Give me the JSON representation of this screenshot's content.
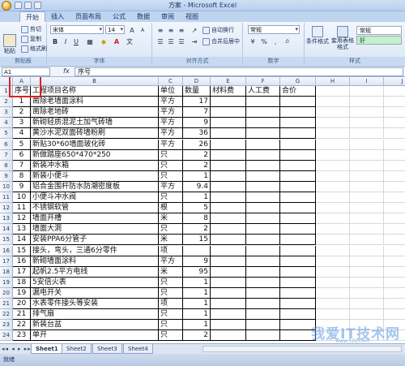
{
  "window": {
    "title": "方案 - Microsoft Excel"
  },
  "ribbon_tabs": [
    "开始",
    "插入",
    "页面布局",
    "公式",
    "数据",
    "审阅",
    "视图"
  ],
  "clipboard": {
    "paste": "粘贴",
    "cut": "剪切",
    "copy": "复制",
    "format_painter": "格式刷",
    "label": "剪贴板"
  },
  "font": {
    "name": "宋体",
    "size": "14",
    "label": "字体"
  },
  "alignment": {
    "wrap": "自动换行",
    "merge": "合并后居中",
    "label": "对齐方式"
  },
  "number": {
    "format": "常规",
    "label": "数字"
  },
  "styles": {
    "conditional": "条件格式",
    "table": "套用表格格式",
    "normal": "常规",
    "good": "好",
    "label": "样式"
  },
  "formula_bar": {
    "name_box": "A1",
    "fx": "fx",
    "value": "序号"
  },
  "columns": [
    "A",
    "B",
    "C",
    "D",
    "E",
    "F",
    "G",
    "H",
    "I",
    "J"
  ],
  "headers": {
    "a": "序号",
    "b": "工程项目名称",
    "c": "单位",
    "d": "数量",
    "e": "材料费",
    "f": "人工费",
    "g": "合价"
  },
  "rows": [
    {
      "no": "1",
      "name": "凿除老墙面涂料",
      "unit": "平方",
      "qty": "17"
    },
    {
      "no": "2",
      "name": "凿除老地砖",
      "unit": "平方",
      "qty": "7"
    },
    {
      "no": "3",
      "name": "新砌轻质混泥土加气砖墙",
      "unit": "平方",
      "qty": "9"
    },
    {
      "no": "4",
      "name": "黄沙水泥双面砖墙粉刷",
      "unit": "平方",
      "qty": "36"
    },
    {
      "no": "5",
      "name": "新贴30*60墙面玻化砖",
      "unit": "平方",
      "qty": "26"
    },
    {
      "no": "6",
      "name": "新做踏座650*470*250",
      "unit": "只",
      "qty": "2"
    },
    {
      "no": "7",
      "name": "新装冲水箱",
      "unit": "只",
      "qty": "2"
    },
    {
      "no": "8",
      "name": "新装小便斗",
      "unit": "只",
      "qty": "1"
    },
    {
      "no": "9",
      "name": "铝合金围杆防水防潮密度板",
      "unit": "平方",
      "qty": "9.4"
    },
    {
      "no": "10",
      "name": "小便斗冲水阀",
      "unit": "只",
      "qty": "1"
    },
    {
      "no": "11",
      "name": "不锈钢软管",
      "unit": "根",
      "qty": "5"
    },
    {
      "no": "12",
      "name": "墙面开槽",
      "unit": "米",
      "qty": "8"
    },
    {
      "no": "13",
      "name": "墙面大洞",
      "unit": "只",
      "qty": "2"
    },
    {
      "no": "14",
      "name": "安装PPA6分管子",
      "unit": "米",
      "qty": "15"
    },
    {
      "no": "15",
      "name": "接头，弯头，三通6分零件",
      "unit": "项",
      "qty": ""
    },
    {
      "no": "16",
      "name": "新砌墙面涂料",
      "unit": "平方",
      "qty": "9"
    },
    {
      "no": "17",
      "name": "起帆2.5平方电线",
      "unit": "米",
      "qty": "95"
    },
    {
      "no": "18",
      "name": "5安倍火表",
      "unit": "只",
      "qty": "1"
    },
    {
      "no": "19",
      "name": "漏电开关",
      "unit": "只",
      "qty": "1"
    },
    {
      "no": "20",
      "name": "水表零件接头等安装",
      "unit": "项",
      "qty": "1"
    },
    {
      "no": "21",
      "name": "排气扇",
      "unit": "只",
      "qty": "1"
    },
    {
      "no": "22",
      "name": "新装台盆",
      "unit": "只",
      "qty": "1"
    },
    {
      "no": "23",
      "name": "单开",
      "unit": "只",
      "qty": "2"
    }
  ],
  "row_numbers": [
    "1",
    "2",
    "3",
    "4",
    "5",
    "6",
    "7",
    "8",
    "9",
    "10",
    "11",
    "12",
    "13",
    "14",
    "15",
    "16",
    "17",
    "18",
    "19",
    "20",
    "21",
    "22",
    "23",
    "24"
  ],
  "sheets": [
    "Sheet1",
    "Sheet2",
    "Sheet3",
    "Sheet4"
  ],
  "status": "就绪",
  "watermark": {
    "main": "我爱IT技术网",
    "sub": "www.52ij.com"
  }
}
